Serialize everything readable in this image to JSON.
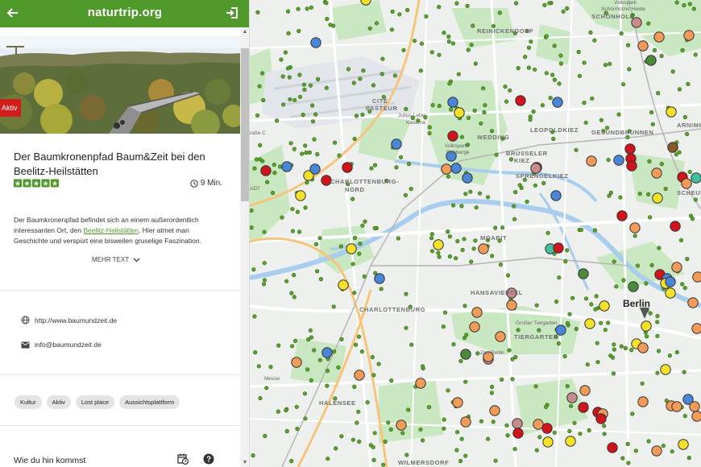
{
  "topbar": {
    "brand": "naturtrip.org",
    "back_icon": "arrow-left-icon",
    "exit_icon": "login-icon"
  },
  "hero": {
    "badge": "Aktiv",
    "image": "treetop-walkway-photo"
  },
  "detail": {
    "title": "Der Baumkronenpfad Baum&Zeit bei den Beelitz-Heilstätten",
    "rating_stars": 5,
    "duration": "9 Min.",
    "description_before": "Der Baumkronenpfad befindet sich an einem außerordentlich interessanten Ort, den ",
    "description_link": "Beelitz-Heilstätten",
    "description_after": ". Hier atmet man Geschichte und verspürt eine bisweilen gruselige Faszination.",
    "more_label": "MEHR TEXT"
  },
  "contact": {
    "website": "http://www.baumundzeit.de",
    "email": "info@baumundzeit.de"
  },
  "tags": [
    "Kultur",
    "Aktiv",
    "Lost place",
    "Aussichtsplattform"
  ],
  "directions": {
    "label": "Wie du hin kommst"
  },
  "map": {
    "city": "Berlin",
    "districts": [
      "REINICKENDORF",
      "CITÉ",
      "PASTEUR",
      "WEDDING",
      "LEOPOLDKIEZ",
      "GESUNDBRUNNEN",
      "BRÜSSELER",
      "KIEZ",
      "SPRENGELKIEZ",
      "CHARLOTTENBURG-",
      "NORD",
      "MOABIT",
      "HANSAVIERTEL",
      "CHARLOTTENBURG",
      "TIERGARTEN",
      "HALENSEE",
      "WILMERSDORF",
      "SCHEUNENV",
      "ARNIMK",
      "SCHÖNHOLZ"
    ],
    "places": [
      "Julius-Leber-",
      "Kaserne",
      "Volkspark",
      "Rehberge",
      "Großer Tiergarten",
      "Zoo Berlin",
      "Volkspark",
      "Schönholzer Heide",
      "Messe",
      "raße C",
      "ADT"
    ],
    "marker_colors": {
      "red": "#d0141b",
      "blue": "#4a86d8",
      "yellow": "#f5e02a",
      "orange": "#f29b58",
      "green": "#4a8a3a",
      "mauve": "#c88a8a",
      "brown": "#8b5a2b",
      "teal": "#3fbfa0",
      "dot": "#5aa02c"
    }
  }
}
